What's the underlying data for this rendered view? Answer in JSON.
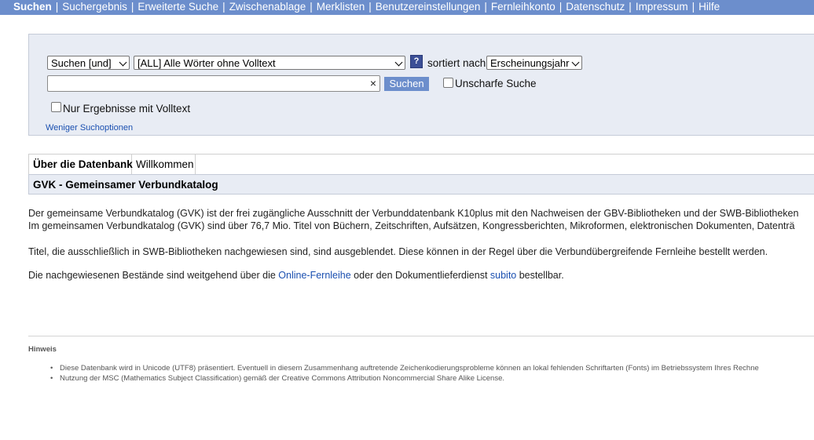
{
  "nav": {
    "items": [
      "Suchen",
      "Suchergebnis",
      "Erweiterte Suche",
      "Zwischenablage",
      "Merklisten",
      "Benutzereinstellungen",
      "Fernleihkonto",
      "Datenschutz",
      "Impressum",
      "Hilfe"
    ],
    "active": "Suchen",
    "bg_color": "#6c8ecc"
  },
  "search": {
    "operator_select": "Suchen [und]",
    "field_select": "[ALL] Alle Wörter ohne Volltext",
    "help_label": "?",
    "sort_label": "sortiert nach",
    "sort_select": "Erscheinungsjahr",
    "query_value": "",
    "clear_label": "×",
    "submit_label": "Suchen",
    "fuzzy_label": "Unscharfe Suche",
    "fulltext_label": "Nur Ergebnisse mit Volltext",
    "fewer_options_label": "Weniger Suchoptionen"
  },
  "tabs": [
    {
      "label": "Über die Datenbank",
      "active": true
    },
    {
      "label": "Willkommen",
      "active": false
    }
  ],
  "section_title": "GVK - Gemeinsamer Verbundkatalog",
  "content": {
    "p1_line1": "Der gemeinsame Verbundkatalog (GVK) ist der frei zugängliche Ausschnitt der Verbunddatenbank K10plus mit den Nachweisen der GBV-Bibliotheken und der SWB-Bibliotheken",
    "p1_line2": "Im gemeinsamen Verbundkatalog (GVK) sind über 76,7 Mio. Titel von Büchern, Zeitschriften, Aufsätzen, Kongressberichten, Mikroformen, elektronischen Dokumenten, Datenträ",
    "p2": "Titel, die ausschließlich in SWB-Bibliotheken nachgewiesen sind, sind ausgeblendet. Diese können in der Regel über die Verbundübergreifende Fernleihe bestellt werden.",
    "p3_before": "Die nachgewiesenen Bestände sind weitgehend über die ",
    "p3_link1": "Online-Fernleihe",
    "p3_middle": " oder den Dokumentlieferdienst ",
    "p3_link2": "subito",
    "p3_after": " bestellbar."
  },
  "footer": {
    "heading": "Hinweis",
    "notes": [
      "Diese Datenbank wird in Unicode (UTF8) präsentiert. Eventuell in diesem Zusammenhang auftretende Zeichenkodierungsprobleme können an lokal fehlenden Schriftarten (Fonts) im Betriebssystem Ihres Rechne",
      "Nutzung der MSC (Mathematics Subject Classification) gemäß der Creative Commons Attribution Noncommercial Share Alike License."
    ]
  }
}
